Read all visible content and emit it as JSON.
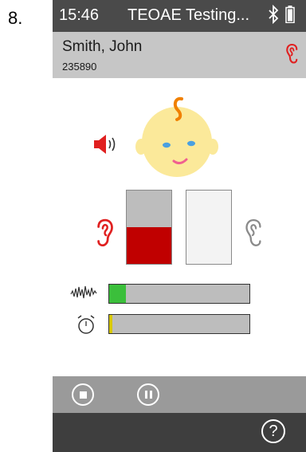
{
  "step_number": "8.",
  "status_bar": {
    "time": "15:46",
    "title": "TEOAE Testing...",
    "bluetooth_icon": "bluetooth-icon",
    "battery_icon": "battery-icon"
  },
  "patient": {
    "name": "Smith, John",
    "id": "235890",
    "ear_icon": "ear-icon"
  },
  "colors": {
    "accent_red": "#e02020",
    "meter_fill_red": "#c00000",
    "noise_green": "#3bbf3b",
    "timer_yellow": "#d8c800",
    "baby_face": "#fbe99a",
    "baby_hair": "#f08000",
    "status_bar": "#4a4a4a",
    "patient_bar": "#c6c6c6",
    "controls_bar": "#9a9a9a",
    "footer_bar": "#3e3e3e"
  },
  "test": {
    "stimulus_icon": "speaker-sound-icon",
    "active_ear": "left-ear-red",
    "inactive_ear": "right-ear-gray",
    "left_meter_level": 0.5,
    "right_meter_level": 0.0,
    "noise_level": 0.12,
    "elapsed_fraction": 0.02
  },
  "controls": {
    "stop_icon": "stop-icon",
    "pause_icon": "pause-icon"
  },
  "footer": {
    "help_label": "?"
  }
}
